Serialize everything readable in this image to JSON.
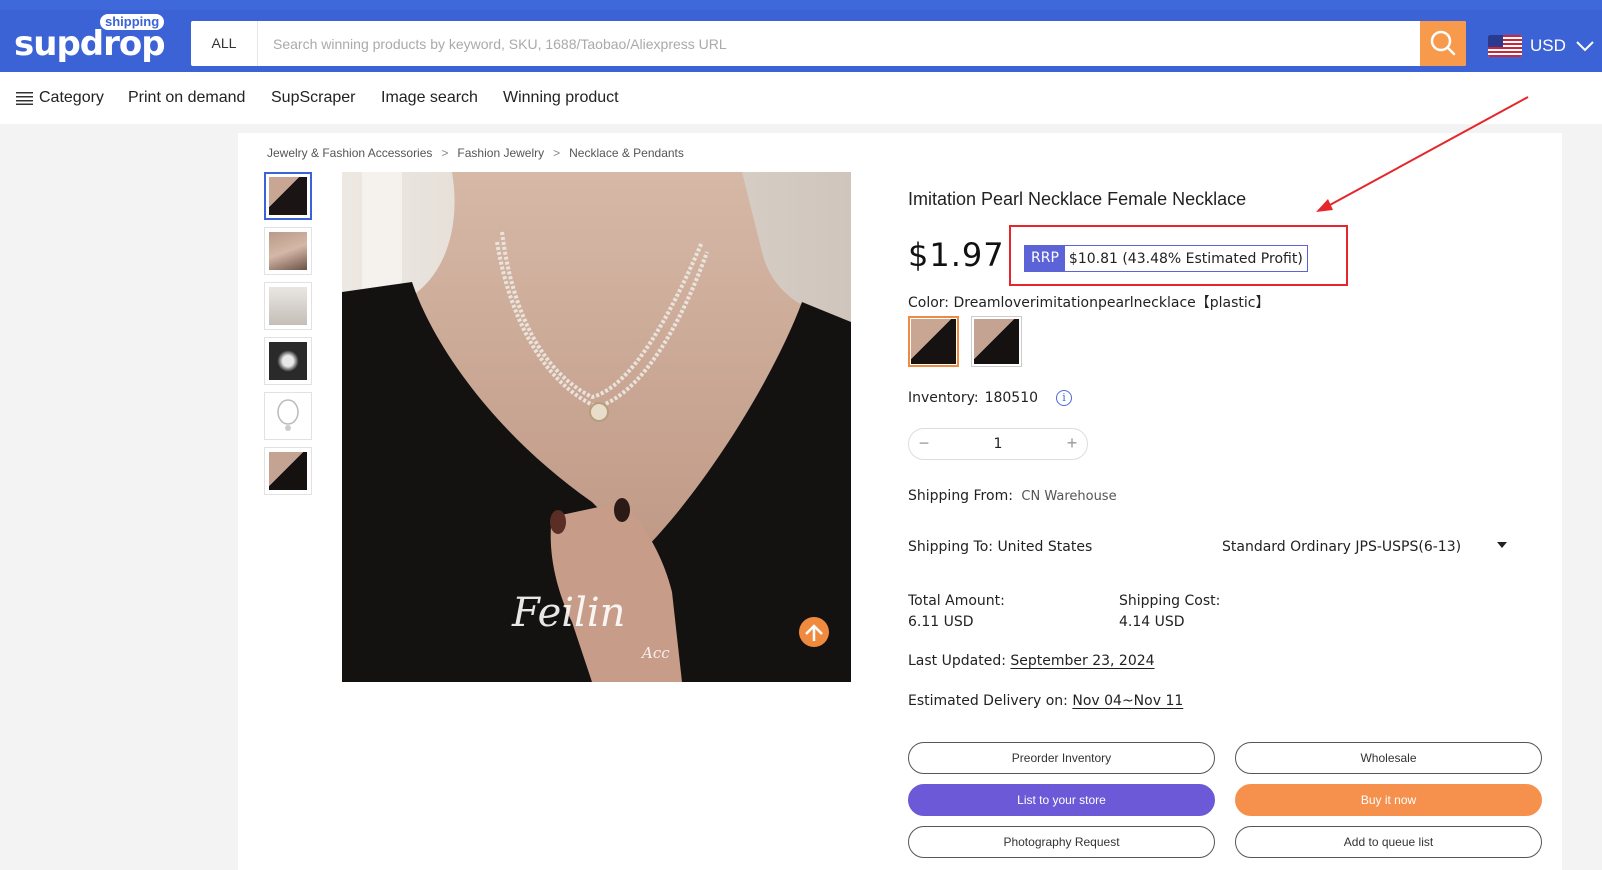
{
  "header": {
    "logo_word": "supdrop",
    "logo_tag": "shipping",
    "search_scope": "ALL",
    "search_placeholder": "Search winning products by keyword, SKU, 1688/Taobao/Aliexpress URL",
    "currency": "USD"
  },
  "nav": {
    "category": "Category",
    "print_on_demand": "Print on demand",
    "supscraper": "SupScraper",
    "image_search": "Image search",
    "winning_product": "Winning product"
  },
  "breadcrumb": [
    "Jewelry & Fashion Accessories",
    "Fashion Jewelry",
    "Necklace & Pendants"
  ],
  "product": {
    "title": "Imitation Pearl Necklace Female Necklace",
    "price": "$1.97",
    "rrp_label": "RRP",
    "rrp_value": "$10.81 (43.48% Estimated Profit)",
    "color_label": "Color:",
    "color_value": "Dreamloverimitationpearlnecklace【plastic】",
    "inventory_label": "Inventory:",
    "inventory_value": "180510",
    "quantity": "1",
    "shipping_from_label": "Shipping From:",
    "shipping_from_value": "CN Warehouse",
    "shipping_to_label": "Shipping To:",
    "shipping_to_value": "United States",
    "shipping_method": "Standard Ordinary JPS-USPS(6-13)",
    "total_amount_label": "Total Amount:",
    "total_amount_value": "6.11 USD",
    "shipping_cost_label": "Shipping Cost:",
    "shipping_cost_value": "4.14 USD",
    "last_updated_label": "Last Updated:",
    "last_updated_value": "September 23, 2024",
    "delivery_label": "Estimated Delivery on:",
    "delivery_value": "Nov 04~Nov 11",
    "watermark": "Feilin",
    "watermark_sub": "Acc"
  },
  "actions": {
    "preorder": "Preorder Inventory",
    "wholesale": "Wholesale",
    "list_store": "List to your store",
    "buy_now": "Buy it now",
    "photography": "Photography Request",
    "queue": "Add to queue list"
  },
  "colors": {
    "brand_blue": "#3c63d6",
    "accent_orange": "#f79a4b",
    "purple": "#6b59d8",
    "highlight_red": "#e5262b"
  }
}
